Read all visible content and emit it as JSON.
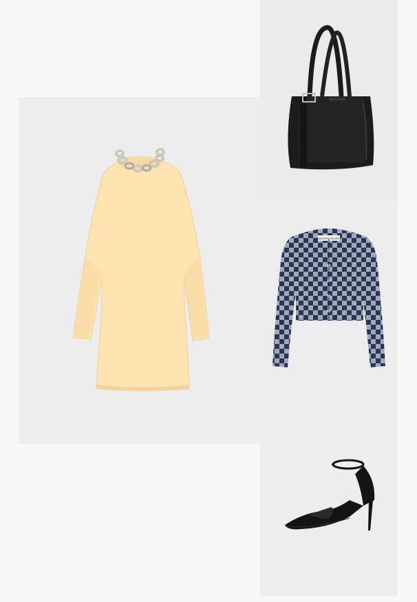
{
  "collage": {
    "items": [
      {
        "name": "cream-knit-dress-with-chain-necklace",
        "background": "#ededed"
      },
      {
        "name": "black-leather-tote-bag",
        "background": "#ebebeb"
      },
      {
        "name": "navy-checkerboard-denim-jacket",
        "background": "#ececec"
      },
      {
        "name": "black-pointed-ankle-strap-pump",
        "background": "#ededed"
      }
    ]
  },
  "colors": {
    "page_background": "#f7f7f7",
    "dress": "#fde3b0",
    "necklace": "#d8d2c4",
    "bag": "#1c1c1c",
    "jacket_dark": "#2b3552",
    "jacket_light": "#9fa9be",
    "heel": "#141414"
  },
  "labels": {
    "bag_brand_stamp": "rag & bone",
    "jacket_label": "ANDERSSON BELL"
  }
}
